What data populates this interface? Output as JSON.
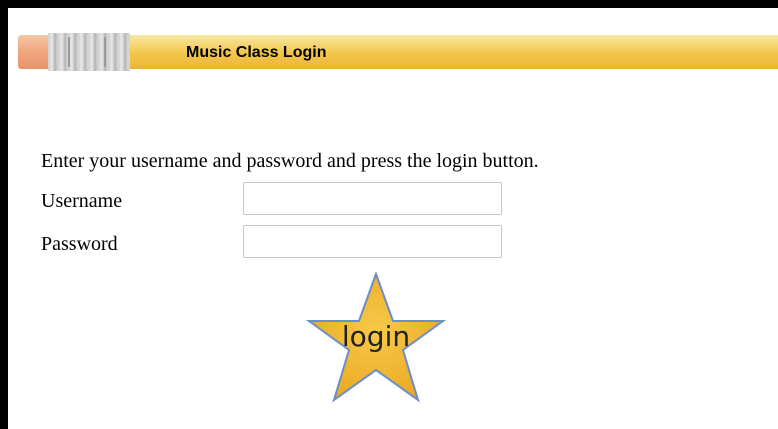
{
  "header": {
    "title": "Music Class Login"
  },
  "form": {
    "instructions": "Enter your username and password and press the login button.",
    "username_label": "Username",
    "password_label": "Password",
    "username_value": "",
    "password_value": "",
    "login_label": "login"
  },
  "colors": {
    "star_fill": "#f5b82e",
    "star_stroke": "#6a8fc8",
    "pencil_body": "#f2c648"
  }
}
